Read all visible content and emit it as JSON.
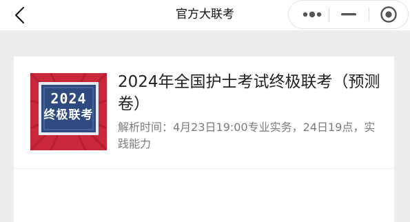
{
  "nav": {
    "title": "官方大联考",
    "back_icon": "chevron-left-icon",
    "more_icon": "more-dots-icon",
    "minimize_icon": "minimize-icon",
    "close_icon": "target-close-icon"
  },
  "card": {
    "thumbnail": {
      "year": "2024",
      "caption": "终极联考",
      "colors": {
        "background": "#c8283a",
        "panel": "#2f4a7e",
        "panel_border": "#e6e9f0"
      }
    },
    "title": "2024年全国护士考试终极联考（预测卷）",
    "description": "解析时间：4月23日19:00专业实务，24日19点，实践能力"
  },
  "colors": {
    "page_background": "#ededed",
    "nav_background": "#ffffff",
    "title_text": "#222222",
    "secondary_text": "#7a7a7a"
  }
}
